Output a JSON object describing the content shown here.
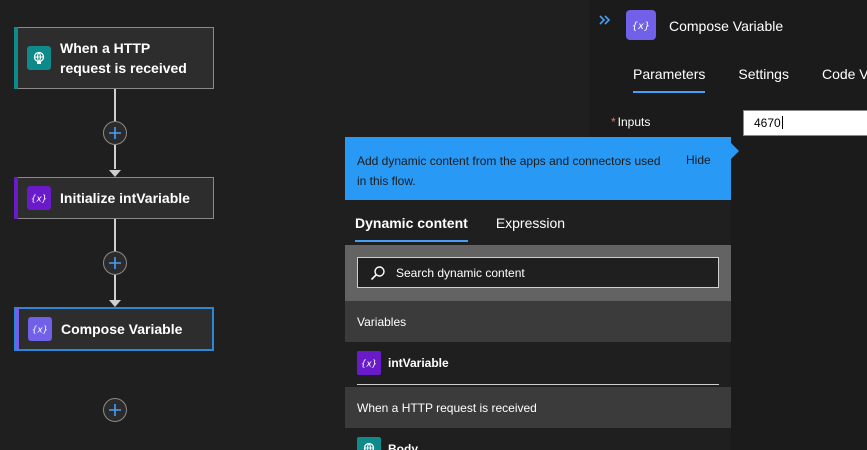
{
  "flow": {
    "steps": [
      {
        "title": "When a HTTP request is received",
        "icon": "http-request-icon",
        "color": "#0f8a8a"
      },
      {
        "title": "Initialize intVariable",
        "icon": "variable-icon",
        "color": "#6a1bc9"
      },
      {
        "title": "Compose Variable",
        "icon": "compose-icon",
        "color": "#7160e8"
      }
    ]
  },
  "panel": {
    "title": "Compose Variable",
    "tabs": [
      "Parameters",
      "Settings",
      "Code Vi"
    ],
    "inputs_label": "Inputs",
    "required_mark": "*",
    "inputs_value": "4670"
  },
  "popup": {
    "description": "Add dynamic content from the apps and connectors used in this flow.",
    "hide_label": "Hide",
    "tabs": [
      "Dynamic content",
      "Expression"
    ],
    "search_placeholder": "Search dynamic content",
    "sections": [
      {
        "title": "Variables",
        "items": [
          {
            "label": "intVariable",
            "icon": "variable-icon"
          }
        ]
      },
      {
        "title": "When a HTTP request is received",
        "items": [
          {
            "label": "Body",
            "icon": "http-request-icon"
          }
        ]
      }
    ]
  },
  "colors": {
    "accent_blue": "#2899f5",
    "tab_underline": "#479ef5",
    "variable_purple": "#6a1bc9",
    "compose_purple": "#7160e8",
    "http_teal": "#0f8a8a",
    "selected_border": "#2b88d8",
    "required_red": "#ff6a6a"
  }
}
